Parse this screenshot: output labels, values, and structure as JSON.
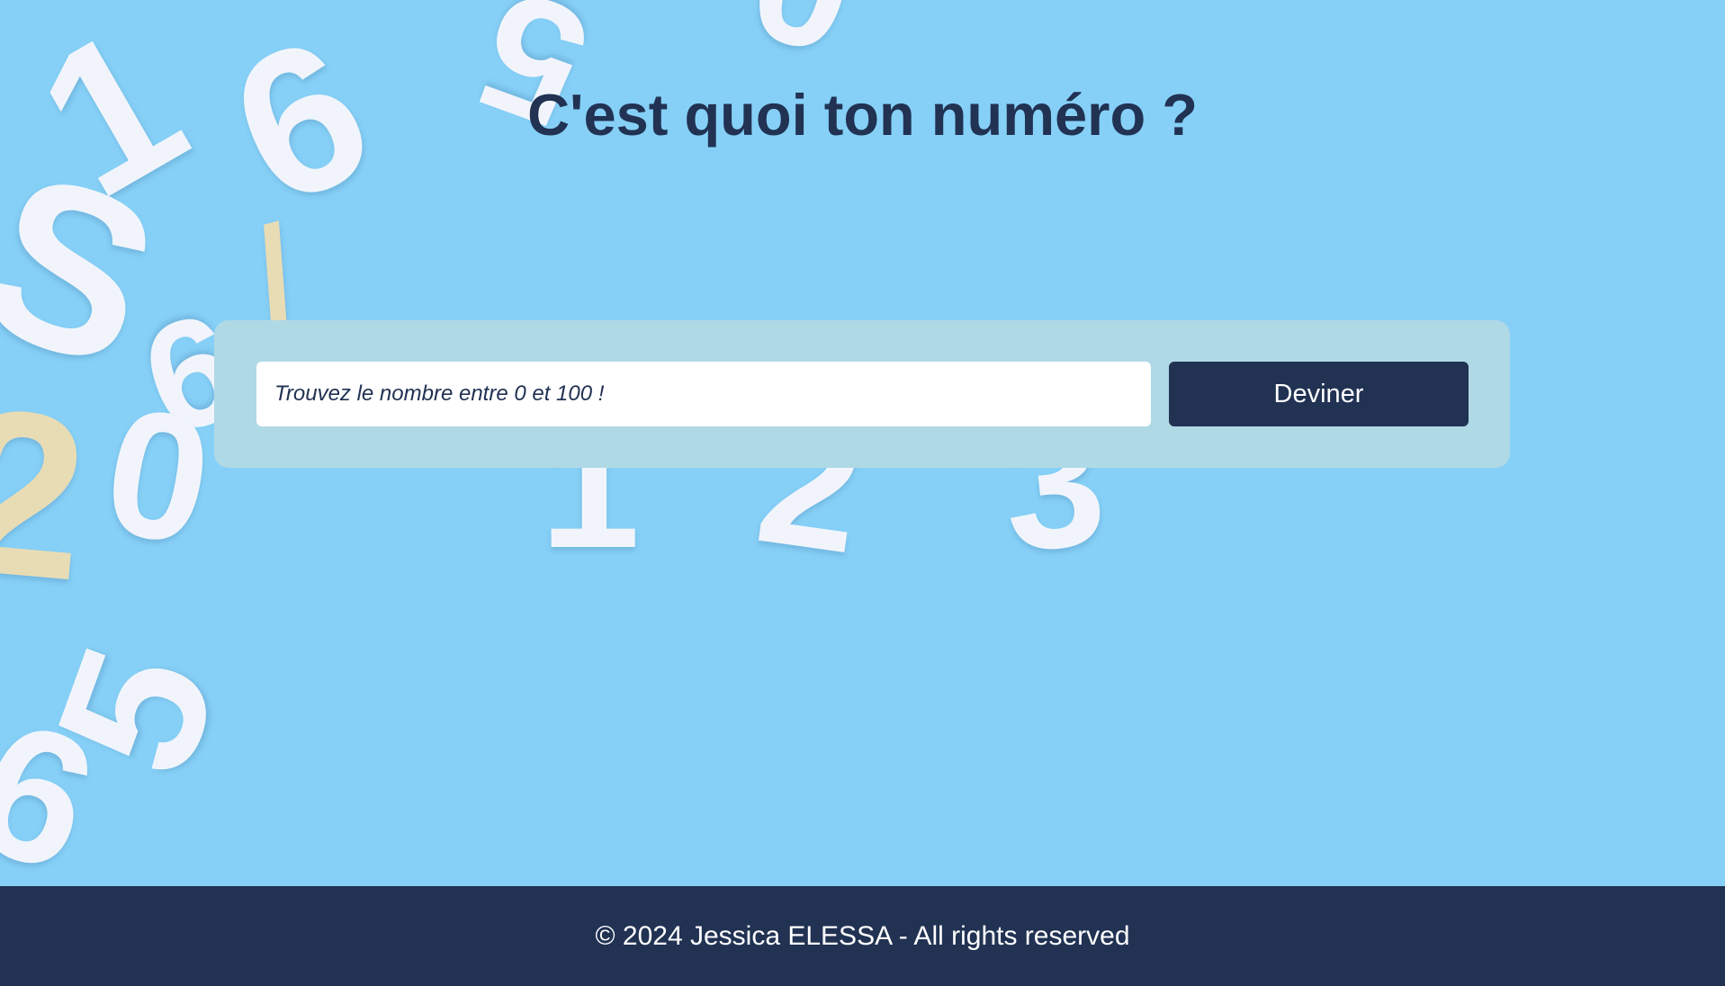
{
  "page": {
    "title": "C'est quoi ton numéro ?"
  },
  "game": {
    "input_placeholder": "Trouvez le nombre entre 0 et 100 !",
    "input_value": "",
    "button_label": "Deviner"
  },
  "footer": {
    "text": "© 2024 Jessica ELESSA - All rights reserved"
  },
  "colors": {
    "background": "#86d0f7",
    "primary": "#213253",
    "panel": "#b0d9e6",
    "button_text": "#ffffff"
  }
}
